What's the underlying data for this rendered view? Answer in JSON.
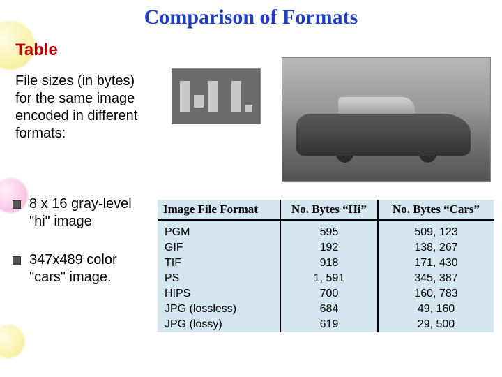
{
  "title": "Comparison of Formats",
  "subtitle": "Table",
  "intro": "File sizes (in bytes) for the same image encoded in different formats:",
  "bullets": [
    "8 x 16 gray‑level \"hi\" image",
    "347x489 color \"cars\" image."
  ],
  "table": {
    "headers": [
      "Image File Format",
      "No. Bytes “Hi”",
      "No. Bytes “Cars”"
    ],
    "rows": [
      {
        "format": "PGM",
        "hi": "595",
        "cars": "509, 123"
      },
      {
        "format": "GIF",
        "hi": "192",
        "cars": "138, 267"
      },
      {
        "format": "TIF",
        "hi": "918",
        "cars": "171, 430"
      },
      {
        "format": "PS",
        "hi": "1, 591",
        "cars": "345, 387"
      },
      {
        "format": "HIPS",
        "hi": "700",
        "cars": "160, 783"
      },
      {
        "format": "JPG (lossless)",
        "hi": "684",
        "cars": "49, 160"
      },
      {
        "format": "JPG (lossy)",
        "hi": "619",
        "cars": "29, 500"
      }
    ]
  },
  "chart_data": {
    "type": "table",
    "title": "File sizes (bytes) by image file format",
    "columns": [
      "Image File Format",
      "No. Bytes \"Hi\"",
      "No. Bytes \"Cars\""
    ],
    "rows": [
      [
        "PGM",
        595,
        509123
      ],
      [
        "GIF",
        192,
        138267
      ],
      [
        "TIF",
        918,
        171430
      ],
      [
        "PS",
        1591,
        345387
      ],
      [
        "HIPS",
        700,
        160783
      ],
      [
        "JPG (lossless)",
        684,
        49160
      ],
      [
        "JPG (lossy)",
        619,
        29500
      ]
    ]
  }
}
